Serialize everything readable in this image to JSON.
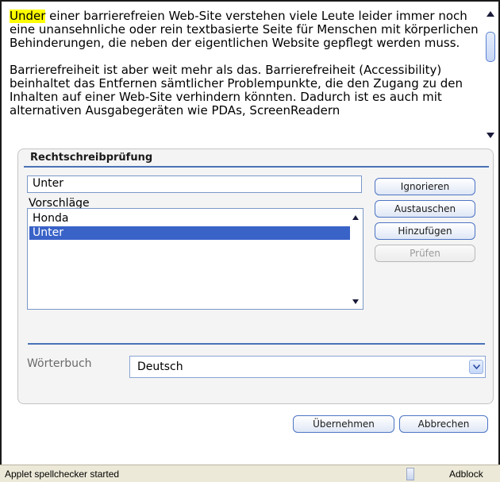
{
  "editor": {
    "highlighted_word": "Under",
    "paragraph1_rest": " einer barrierefreien Web-Site verstehen viele Leute leider immer noch eine unansehnliche oder rein textbasierte Seite für Menschen mit körperlichen Behinderungen, die neben der eigentlichen Website gepflegt werden muss.",
    "paragraph2": "Barrierefreiheit ist aber weit mehr als das. Barrierefreiheit (Accessibility) beinhaltet das Entfernen sämtlicher Problempunkte, die den Zugang zu den Inhalten auf einer Web-Site verhindern könnten. Dadurch ist es auch mit alternativen Ausgabegeräten wie PDAs, ScreenReadern"
  },
  "dialog": {
    "title": "Rechtschreibprüfung",
    "word_value": "Unter",
    "suggestions_label": "Vorschläge",
    "suggestions": [
      "Honda",
      "Unter"
    ],
    "selected_suggestion": "Unter",
    "buttons": {
      "ignore": "Ignorieren",
      "replace": "Austauschen",
      "add": "Hinzufügen",
      "check": "Prüfen"
    },
    "dictionary_label": "Wörterbuch",
    "dictionary_value": "Deutsch"
  },
  "footer": {
    "apply": "Übernehmen",
    "cancel": "Abbrechen"
  },
  "statusbar": {
    "text": "Applet spellchecker started",
    "adblock": "Adblock"
  },
  "colors": {
    "highlight": "#ffff00",
    "selection": "#3a63c8",
    "accent": "#4a72b8"
  }
}
